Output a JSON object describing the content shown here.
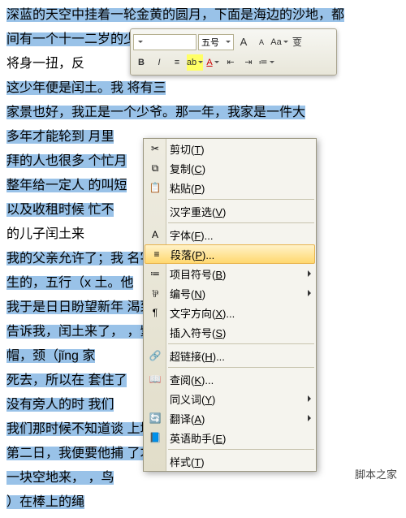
{
  "lines": [
    "深蓝的天空中挂着一轮金黄的圆月，下面是海边的沙地，都",
    "间有一个十一二岁的少年，项带银圈，手捏一柄钢叉",
    "将身一扭，反",
    "这少年便是闰土。我                                        将有三",
    "家景也好，我正是一个少爷。那一年，我家是一件大",
    "多年才能轮到                                              月里",
    "拜的人也很多                                              个忙月",
    "整年给一定人                                              的叫短",
    "以及收租时候                                              忙不",
    "的儿子闰土来",
    "我的父亲允许了；我                                        名字，",
    "生的，五行（x                                             土。他",
    "我于是日日盼望新年                                        渴到了",
    "告诉我，闰土来了，                                        ，紫色",
    "帽，颈（jǐng                                              家",
    "死去，所以在                                              套住了",
    "没有旁人的时                                              我们",
    "我们那时候不知道谈                                        上城之",
    "第二日，我便要他捕                                        了才好",
    "一块空地来，                                              ，鸟",
    "）在棒上的绳"
  ],
  "noSel": [
    2,
    9
  ],
  "mini": {
    "fontName": "",
    "fontSize": "五号",
    "growA": "A",
    "shrinkA": "A",
    "bold": "B",
    "italic": "I"
  },
  "menu": [
    {
      "key": "cut",
      "icon": "✂",
      "label": "剪切",
      "k": "T"
    },
    {
      "key": "copy",
      "icon": "⧉",
      "label": "复制",
      "k": "C"
    },
    {
      "key": "paste",
      "icon": "📋",
      "label": "粘贴",
      "k": "P"
    },
    {
      "sep": true
    },
    {
      "key": "reselect",
      "icon": "",
      "label": "汉字重选",
      "k": "V"
    },
    {
      "sep": true
    },
    {
      "key": "font",
      "icon": "A",
      "label": "字体",
      "k": "F",
      "ell": true
    },
    {
      "key": "para",
      "icon": "≡",
      "label": "段落",
      "k": "P",
      "ell": true,
      "hl": true
    },
    {
      "key": "bullets",
      "icon": "≔",
      "label": "项目符号",
      "k": "B",
      "sub": true
    },
    {
      "key": "number",
      "icon": "⅌",
      "label": "编号",
      "k": "N",
      "sub": true
    },
    {
      "key": "dir",
      "icon": "¶",
      "label": "文字方向",
      "k": "X",
      "ell": true
    },
    {
      "key": "sym",
      "icon": "",
      "label": "插入符号",
      "k": "S"
    },
    {
      "sep": true
    },
    {
      "key": "link",
      "icon": "🔗",
      "label": "超链接",
      "k": "H",
      "ell": true
    },
    {
      "sep": true
    },
    {
      "key": "lookup",
      "icon": "📖",
      "label": "查阅",
      "k": "K",
      "ell": true
    },
    {
      "key": "thes",
      "icon": "",
      "label": "同义词",
      "k": "Y",
      "sub": true
    },
    {
      "key": "trans",
      "icon": "🔄",
      "label": "翻译",
      "k": "A",
      "sub": true
    },
    {
      "key": "eng",
      "icon": "📘",
      "label": "英语助手",
      "k": "E"
    },
    {
      "sep": true
    },
    {
      "key": "style",
      "icon": "",
      "label": "样式",
      "k": "T"
    }
  ],
  "watermark": "脚本之家"
}
